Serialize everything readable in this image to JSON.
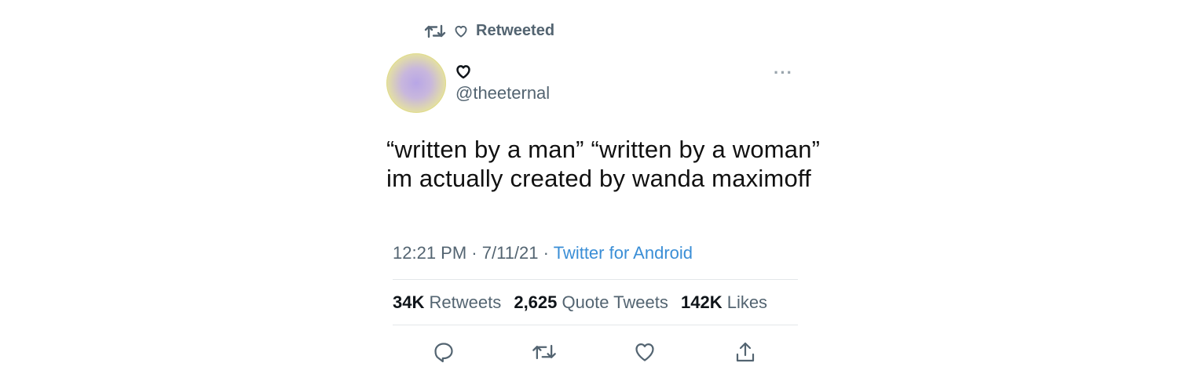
{
  "retweet_banner": {
    "label": "Retweeted",
    "icons": [
      "retweet-icon",
      "heart-icon"
    ]
  },
  "author": {
    "display_name_icon": "heart-icon",
    "handle": "@theeternal",
    "more_label": "···"
  },
  "tweet": {
    "text": "“written by a man” “written by a woman” im actually created by wanda maximoff"
  },
  "meta": {
    "time": "12:21 PM",
    "date": "7/11/21",
    "separator": "·",
    "source": "Twitter for Android"
  },
  "stats": {
    "retweets_count": "34K",
    "retweets_label": "Retweets",
    "quotes_count": "2,625",
    "quotes_label": "Quote Tweets",
    "likes_count": "142K",
    "likes_label": "Likes"
  },
  "actions": [
    "reply-icon",
    "retweet-icon",
    "like-icon",
    "share-icon"
  ],
  "colors": {
    "muted": "#536471",
    "link": "#3a8ed6",
    "text": "#0f1419",
    "divider": "#e3e7ea"
  }
}
